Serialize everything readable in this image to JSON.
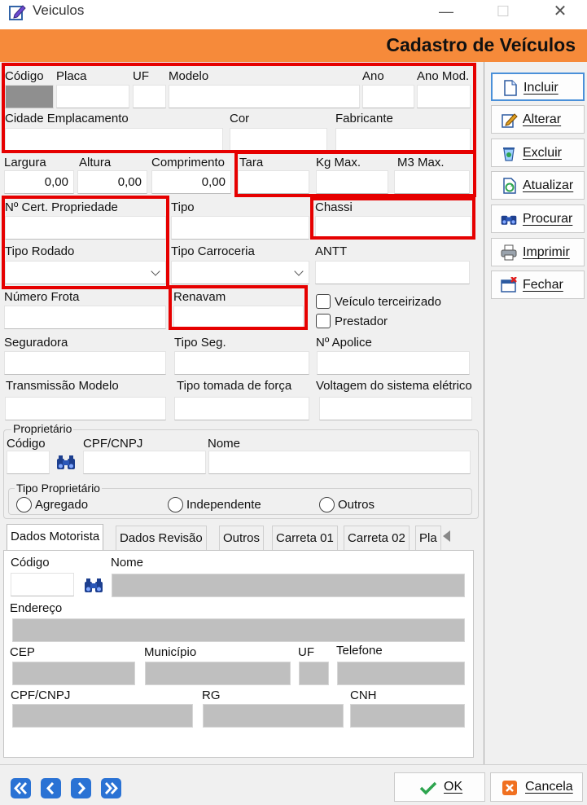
{
  "window": {
    "title": "Veiculos",
    "minimize": "—",
    "maximize": "☐",
    "close": "✕"
  },
  "banner": {
    "title": "Cadastro de Veículos"
  },
  "fields": {
    "codigo": "Código",
    "placa": "Placa",
    "uf": "UF",
    "modelo": "Modelo",
    "ano": "Ano",
    "ano_mod": "Ano Mod.",
    "cidade": "Cidade Emplacamento",
    "cor": "Cor",
    "fabricante": "Fabricante",
    "largura": "Largura",
    "altura": "Altura",
    "comprimento": "Comprimento",
    "tara": "Tara",
    "kg_max": "Kg Max.",
    "m3_max": "M3 Max.",
    "cert": "Nº Cert. Propriedade",
    "tipo": "Tipo",
    "chassi": "Chassi",
    "tipo_rodado": "Tipo Rodado",
    "tipo_carroceria": "Tipo Carroceria",
    "antt": "ANTT",
    "numero_frota": "Número Frota",
    "renavam": "Renavam",
    "seguradora": "Seguradora",
    "tipo_seg": "Tipo Seg.",
    "apolice": "Nº Apolice",
    "transmissao": "Transmissão Modelo",
    "tomada": "Tipo tomada de força",
    "voltagem": "Voltagem do sistema elétrico"
  },
  "values": {
    "largura": "0,00",
    "altura": "0,00",
    "comprimento": "0,00"
  },
  "checks": {
    "terceirizado": "Veículo terceirizado",
    "prestador": "Prestador"
  },
  "proprietario": {
    "group": "Proprietário",
    "codigo": "Código",
    "cpf": "CPF/CNPJ",
    "nome": "Nome",
    "tipo_group": "Tipo Proprietário",
    "opt1": "Agregado",
    "opt2": "Independente",
    "opt3": "Outros"
  },
  "tabs": [
    "Dados Motorista",
    "Dados Revisão",
    "Outros",
    "Carreta 01",
    "Carreta 02",
    "Pla"
  ],
  "motorista": {
    "codigo": "Código",
    "nome": "Nome",
    "endereco": "Endereço",
    "cep": "CEP",
    "municipio": "Município",
    "uf": "UF",
    "telefone": "Telefone",
    "cpf": "CPF/CNPJ",
    "rg": "RG",
    "cnh": "CNH"
  },
  "side_buttons": {
    "incluir": "Incluir",
    "alterar": "Alterar",
    "excluir": "Excluir",
    "atualizar": "Atualizar",
    "procurar": "Procurar",
    "imprimir": "Imprimir",
    "fechar": "Fechar"
  },
  "bottom": {
    "ok": "OK",
    "cancela": "Cancela"
  },
  "colors": {
    "banner": "#f68a3a",
    "highlight": "#e60000",
    "nav": "#2a72d4"
  }
}
